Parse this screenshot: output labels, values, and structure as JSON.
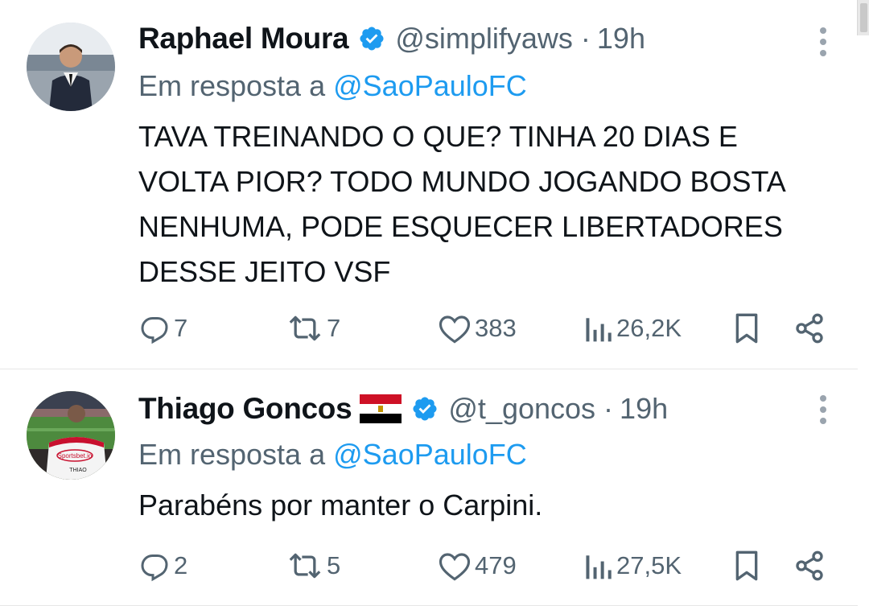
{
  "tweets": [
    {
      "name": "Raphael Moura",
      "handle": "@simplifyaws",
      "separator": "·",
      "time": "19h",
      "reply_prefix": "Em resposta a",
      "reply_to": "@SaoPauloFC",
      "text": "TAVA TREINANDO O QUE? TINHA 20 DIAS E VOLTA PIOR? TODO MUNDO JOGANDO BOSTA NENHUMA, PODE ESQUECER LIBERTADORES DESSE JEITO VSF",
      "replies": "7",
      "retweets": "7",
      "likes": "383",
      "views": "26,2K"
    },
    {
      "name": "Thiago Goncos",
      "handle": "@t_goncos",
      "separator": "·",
      "time": "19h",
      "reply_prefix": "Em resposta a",
      "reply_to": "@SaoPauloFC",
      "text": "Parabéns por manter o Carpini.",
      "replies": "2",
      "retweets": "5",
      "likes": "479",
      "views": "27,5K",
      "avatar_text": "Sportsbet.io",
      "avatar_jersey_name": "THIAO"
    }
  ],
  "colors": {
    "text": "#0f1419",
    "secondary": "#536471",
    "accent": "#1d9bf0",
    "verified": "#1d9bf0"
  },
  "icons": [
    "verified-badge-icon",
    "more-options-icon",
    "reply-icon",
    "retweet-icon",
    "like-icon",
    "views-icon",
    "bookmark-icon",
    "share-icon",
    "egypt-flag-emoji"
  ]
}
